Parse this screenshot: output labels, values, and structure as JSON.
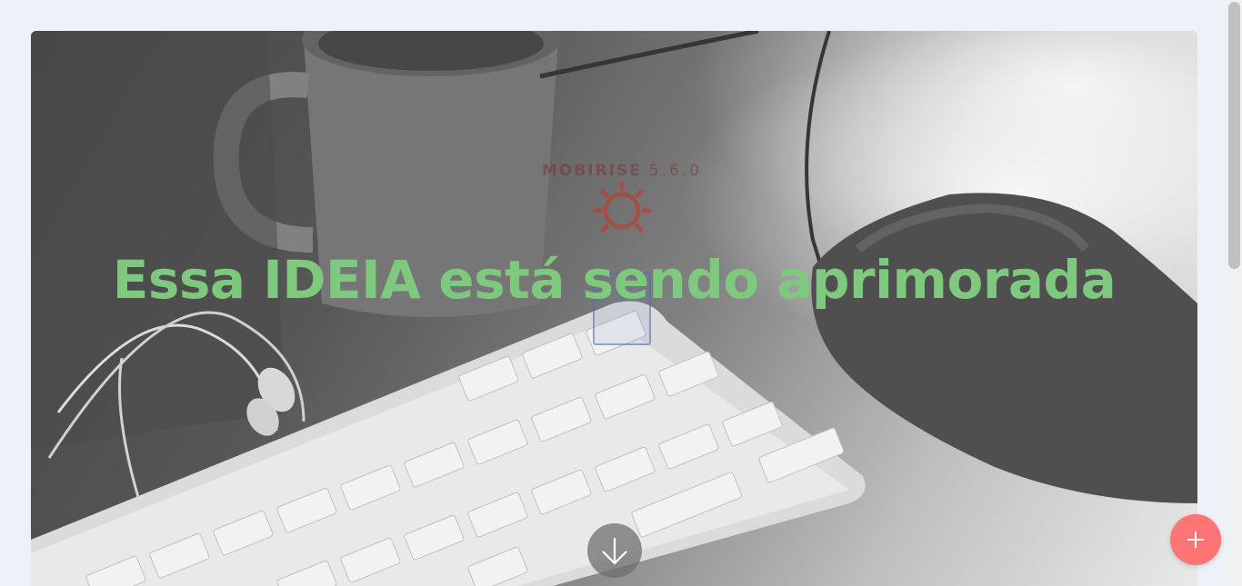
{
  "brand": {
    "name": "MOBIRISE",
    "version": "5.6.0"
  },
  "hero": {
    "headline": "Essa IDEIA está sendo aprimorada",
    "headline_color": "#7ec97e",
    "background_description_icon": "keyboard-mouse-coffee-photo"
  },
  "controls": {
    "scroll_down_icon": "arrow-down-icon",
    "fab_icon": "plus-icon",
    "fab_color": "#ff7474"
  },
  "colors": {
    "page_background": "#eef1f8",
    "brand_text": "#7b3b3b",
    "sun_icon": "#c0392b"
  }
}
